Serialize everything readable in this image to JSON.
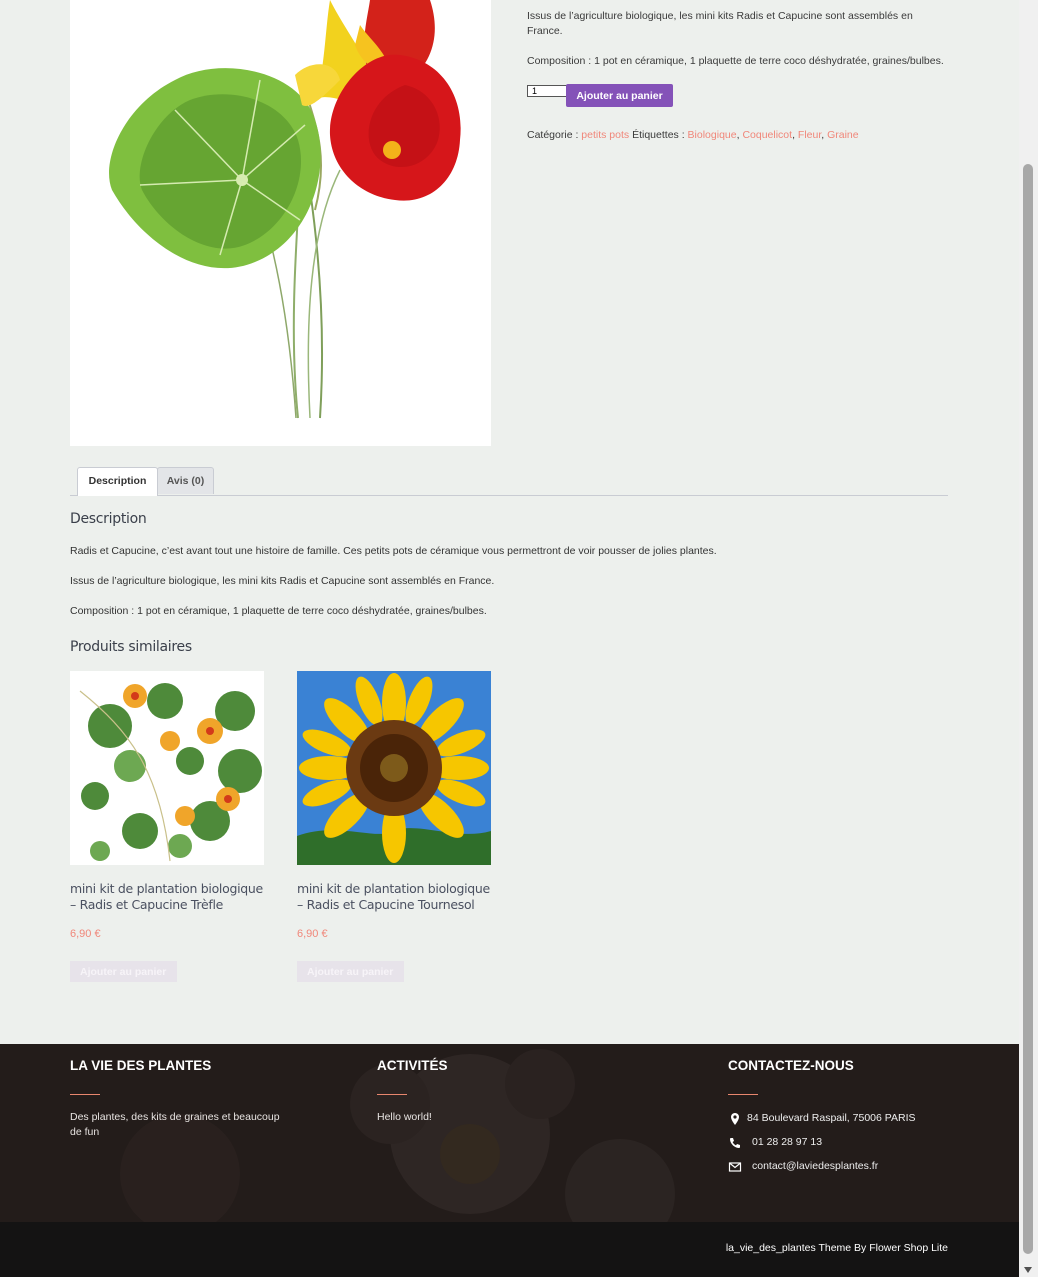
{
  "product": {
    "short_desc_line1": "Issus de l’agriculture biologique, les mini kits Radis et Capucine sont assemblés en France.",
    "composition": "Composition : 1 pot en céramique, 1 plaquette de terre coco déshydratée, graines/bulbes.",
    "quantity": "1",
    "add_to_cart": "Ajouter au panier",
    "category_label": "Catégorie :",
    "category": "petits pots",
    "tags_label": "Étiquettes :",
    "tags": [
      "Biologique",
      "Coquelicot",
      "Fleur",
      "Graine"
    ]
  },
  "tabs": [
    {
      "label": "Description"
    },
    {
      "label": "Avis (0)"
    }
  ],
  "description": {
    "heading": "Description",
    "paragraphs": [
      "Radis et Capucine, c’est avant tout une histoire de famille. Ces petits pots de céramique vous permettront de voir pousser de jolies plantes.",
      "Issus de l’agriculture biologique, les mini kits Radis et Capucine sont assemblés en France.",
      "Composition : 1 pot en céramique, 1 plaquette de terre coco déshydratée, graines/bulbes."
    ]
  },
  "related": {
    "heading": "Produits similaires",
    "items": [
      {
        "title": "mini kit de plantation biologique – Radis et Capucine Trèfle",
        "price": "6,90 €",
        "button": "Ajouter au panier"
      },
      {
        "title": "mini kit de plantation biologique – Radis et Capucine Tournesol",
        "price": "6,90 €",
        "button": "Ajouter au panier"
      }
    ]
  },
  "footer": {
    "col1": {
      "title": "LA VIE DES PLANTES",
      "text": "Des plantes, des kits de graines et beaucoup de fun"
    },
    "col2": {
      "title": "ACTIVITÉS",
      "text": "Hello world!"
    },
    "col3": {
      "title": "CONTACTEZ-NOUS",
      "address": "84 Boulevard Raspail, 75006 PARIS",
      "phone": "01 28 28 97 13",
      "email": "contact@laviedesplantes.fr"
    },
    "credit": "la_vie_des_plantes Theme By Flower Shop Lite"
  },
  "colors": {
    "accent": "#8452b8",
    "link": "#f0877a",
    "footer_bg": "#231c1a",
    "bottom_bar": "#141313",
    "page_bg": "#edf0ed"
  }
}
